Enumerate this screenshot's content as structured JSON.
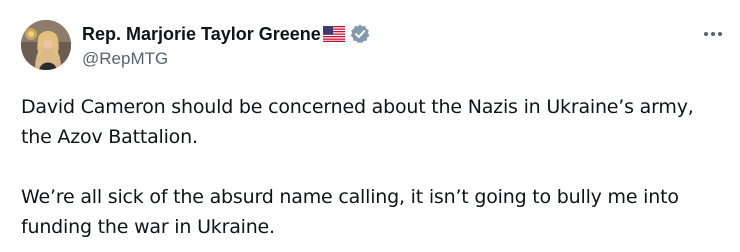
{
  "author": {
    "display_name": "Rep. Marjorie Taylor Greene",
    "handle": "@RepMTG",
    "flag_emoji": "us-flag-icon",
    "verified": true,
    "verified_color": "#829aab"
  },
  "menu": {
    "icon": "more-horizontal-icon"
  },
  "tweet": {
    "paragraphs": [
      "David Cameron should be concerned about the Nazis in Ukraine’s army, the Azov Battalion.",
      "We’re all sick of the absurd name calling, it isn’t going to bully me into funding the war in Ukraine."
    ]
  },
  "colors": {
    "text": "#0f1419",
    "secondary_text": "#536471",
    "background": "#ffffff"
  }
}
